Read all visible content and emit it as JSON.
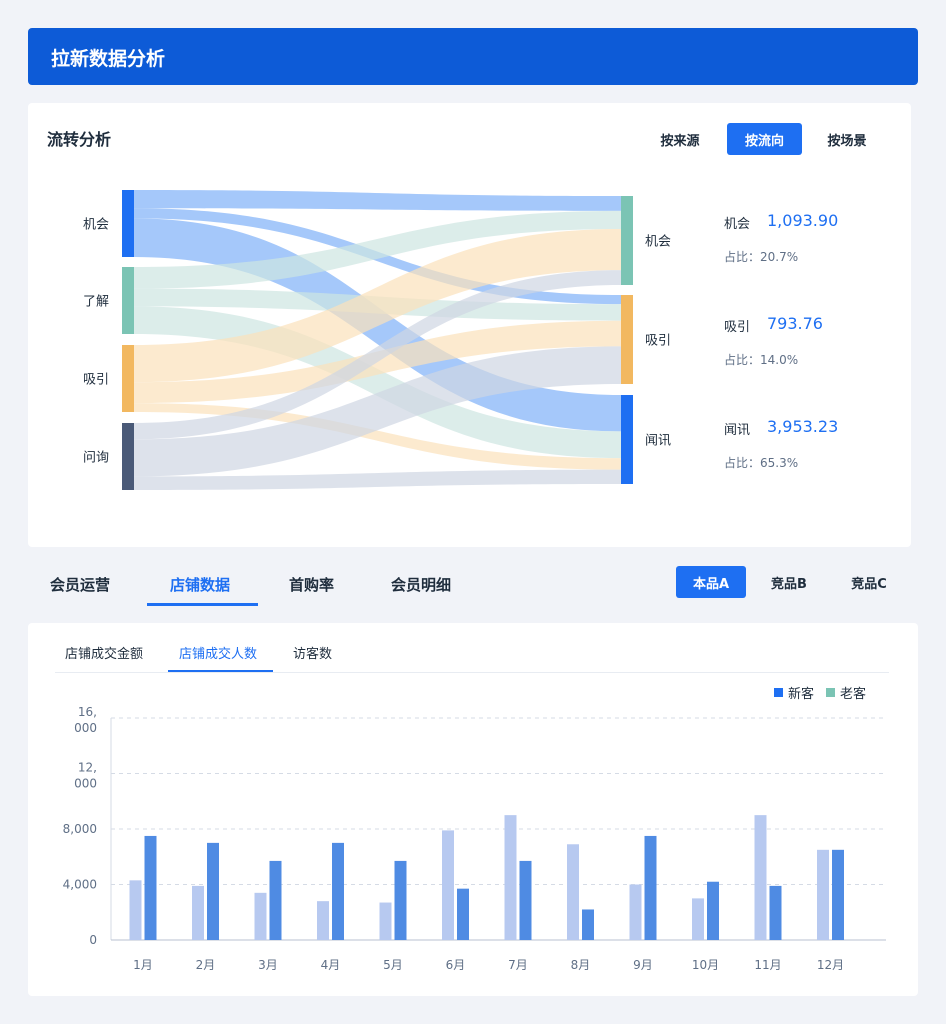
{
  "header": {
    "title": "拉新数据分析"
  },
  "flow": {
    "title": "流转分析",
    "view_options": [
      "按来源",
      "按流向",
      "按场景"
    ],
    "active_view": 1,
    "sources": [
      "机会",
      "了解",
      "吸引",
      "问询"
    ],
    "targets": [
      "机会",
      "吸引",
      "闻讯"
    ],
    "colors": {
      "source": [
        "#1e6ff2",
        "#7bc4b4",
        "#f2b860",
        "#4a5a78"
      ],
      "target": [
        "#7bc4b4",
        "#f2b860",
        "#1e6ff2"
      ],
      "link": [
        "#7fb0f8",
        "#cde6e1",
        "#fbe1ba",
        "#cfd6e2"
      ]
    },
    "metrics": [
      {
        "name": "机会",
        "value": "1,093.90",
        "share": "占比：20.7%"
      },
      {
        "name": "吸引",
        "value": "793.76",
        "share": "占比：14.0%"
      },
      {
        "name": "闻讯",
        "value": "3,953.23",
        "share": "占比：65.3%"
      }
    ]
  },
  "main_tabs": [
    "会员运营",
    "店铺数据",
    "首购率",
    "会员明细"
  ],
  "active_main_tab": 1,
  "products": [
    "本品A",
    "竞品B",
    "竞品C"
  ],
  "active_product": 0,
  "sub_tabs": [
    "店铺成交金额",
    "店铺成交人数",
    "访客数"
  ],
  "active_sub_tab": 1,
  "chart_data": [
    {
      "type": "sankey",
      "sources": [
        "机会",
        "了解",
        "吸引",
        "问询"
      ],
      "targets": [
        "机会",
        "吸引",
        "闻讯"
      ],
      "links": [
        {
          "source": "机会",
          "target": "机会",
          "value": 18
        },
        {
          "source": "机会",
          "target": "吸引",
          "value": 10
        },
        {
          "source": "机会",
          "target": "闻讯",
          "value": 38
        },
        {
          "source": "了解",
          "target": "机会",
          "value": 22
        },
        {
          "source": "了解",
          "target": "吸引",
          "value": 18
        },
        {
          "source": "了解",
          "target": "闻讯",
          "value": 28
        },
        {
          "source": "吸引",
          "target": "机会",
          "value": 50
        },
        {
          "source": "吸引",
          "target": "吸引",
          "value": 28
        },
        {
          "source": "吸引",
          "target": "闻讯",
          "value": 12
        },
        {
          "source": "问询",
          "target": "机会",
          "value": 18
        },
        {
          "source": "问询",
          "target": "吸引",
          "value": 41
        },
        {
          "source": "问询",
          "target": "闻讯",
          "value": 15
        }
      ]
    },
    {
      "type": "bar",
      "categories": [
        "1月",
        "2月",
        "3月",
        "4月",
        "5月",
        "6月",
        "7月",
        "8月",
        "9月",
        "10月",
        "11月",
        "12月"
      ],
      "series": [
        {
          "name": "新客",
          "color": "#b7c9f0",
          "values": [
            4300,
            3900,
            3400,
            2800,
            2700,
            7900,
            9000,
            6900,
            4000,
            3000,
            9000,
            6500
          ]
        },
        {
          "name": "老客",
          "color": "#4f8be3",
          "values": [
            7500,
            7000,
            5700,
            7000,
            5700,
            3700,
            5700,
            2200,
            7500,
            4200,
            3900,
            6500
          ]
        }
      ],
      "legend": [
        {
          "name": "新客",
          "color": "#1e6ff2"
        },
        {
          "name": "老客",
          "color": "#7bc4b4"
        }
      ],
      "y_ticks": [
        "0",
        "4,000",
        "8,000",
        "12,\n000",
        "16,\n000"
      ],
      "ylim": [
        0,
        16000
      ],
      "grid": true,
      "legend_position": "top-right"
    }
  ]
}
